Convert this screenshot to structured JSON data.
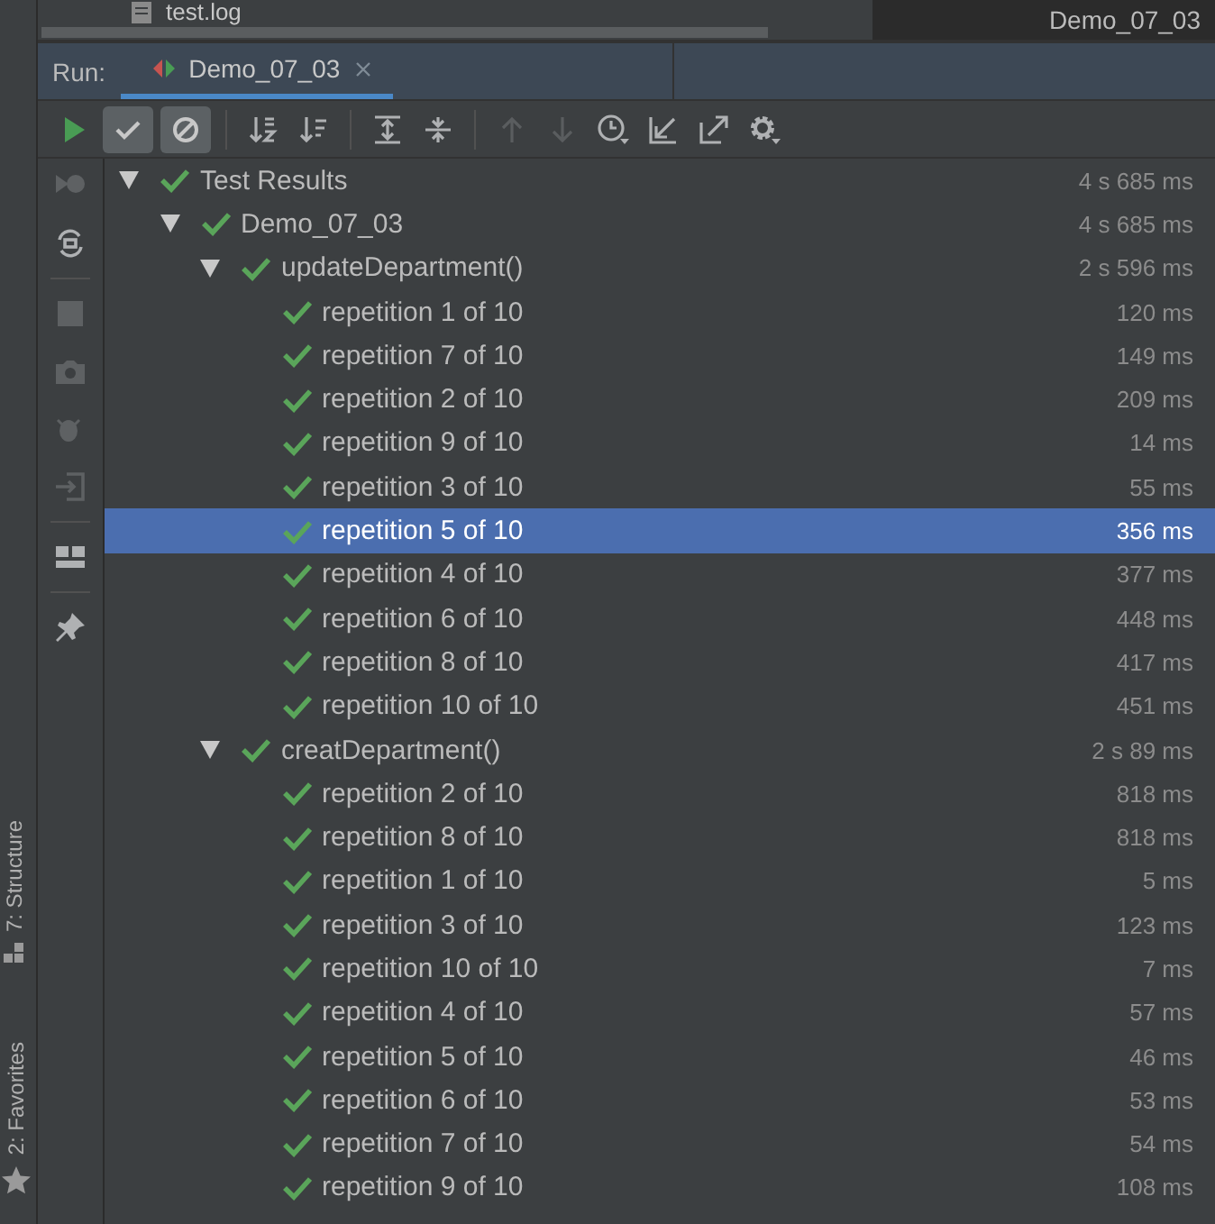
{
  "editor": {
    "file_tab": "test.log",
    "title": "Demo_07_03"
  },
  "run_bar": {
    "label": "Run:",
    "tabs": [
      {
        "label": "Demo_07_03",
        "selected": true
      }
    ]
  },
  "toolbar": [
    {
      "kind": "run"
    },
    {
      "kind": "passed",
      "on": true
    },
    {
      "kind": "ignored",
      "on": true
    },
    {
      "kind": "sep"
    },
    {
      "kind": "sort-alpha",
      "disabled": false
    },
    {
      "kind": "sort-duration",
      "disabled": false
    },
    {
      "kind": "sep"
    },
    {
      "kind": "expand",
      "disabled": false
    },
    {
      "kind": "collapse",
      "disabled": false
    },
    {
      "kind": "sep"
    },
    {
      "kind": "up",
      "disabled": true
    },
    {
      "kind": "down",
      "disabled": true
    },
    {
      "kind": "history",
      "disabled": false
    },
    {
      "kind": "import",
      "disabled": false
    },
    {
      "kind": "export",
      "disabled": false
    },
    {
      "kind": "settings",
      "disabled": false
    }
  ],
  "side_toolbar": [
    {
      "kind": "rerun-failed",
      "disabled": true
    },
    {
      "kind": "auto-test",
      "disabled": false
    },
    {
      "kind": "sep"
    },
    {
      "kind": "stop",
      "disabled": true
    },
    {
      "kind": "camera",
      "disabled": true
    },
    {
      "kind": "debug",
      "disabled": true
    },
    {
      "kind": "exit",
      "disabled": true
    },
    {
      "kind": "sep"
    },
    {
      "kind": "layout",
      "disabled": false
    },
    {
      "kind": "sep"
    },
    {
      "kind": "pin",
      "disabled": false
    }
  ],
  "side_tools": [
    {
      "label": "7: Structure",
      "kind": "structure"
    },
    {
      "label": "2: Favorites",
      "kind": "favorites"
    }
  ],
  "tree": [
    {
      "label": "Test Results",
      "time": "4 s 685 ms",
      "expanded": true,
      "selected": false,
      "children": [
        {
          "label": "Demo_07_03",
          "time": "4 s 685 ms",
          "expanded": true,
          "selected": false,
          "children": [
            {
              "label": "updateDepartment()",
              "time": "2 s 596 ms",
              "expanded": true,
              "selected": false,
              "children": [
                {
                  "label": "repetition 1 of 10",
                  "time": "120 ms",
                  "selected": false
                },
                {
                  "label": "repetition 7 of 10",
                  "time": "149 ms",
                  "selected": false
                },
                {
                  "label": "repetition 2 of 10",
                  "time": "209 ms",
                  "selected": false
                },
                {
                  "label": "repetition 9 of 10",
                  "time": "14 ms",
                  "selected": false
                },
                {
                  "label": "repetition 3 of 10",
                  "time": "55 ms",
                  "selected": false
                },
                {
                  "label": "repetition 5 of 10",
                  "time": "356 ms",
                  "selected": true
                },
                {
                  "label": "repetition 4 of 10",
                  "time": "377 ms",
                  "selected": false
                },
                {
                  "label": "repetition 6 of 10",
                  "time": "448 ms",
                  "selected": false
                },
                {
                  "label": "repetition 8 of 10",
                  "time": "417 ms",
                  "selected": false
                },
                {
                  "label": "repetition 10 of 10",
                  "time": "451 ms",
                  "selected": false
                }
              ]
            },
            {
              "label": "creatDepartment()",
              "time": "2 s 89 ms",
              "expanded": true,
              "selected": false,
              "children": [
                {
                  "label": "repetition 2 of 10",
                  "time": "818 ms",
                  "selected": false
                },
                {
                  "label": "repetition 8 of 10",
                  "time": "818 ms",
                  "selected": false
                },
                {
                  "label": "repetition 1 of 10",
                  "time": "5 ms",
                  "selected": false
                },
                {
                  "label": "repetition 3 of 10",
                  "time": "123 ms",
                  "selected": false
                },
                {
                  "label": "repetition 10 of 10",
                  "time": "7 ms",
                  "selected": false
                },
                {
                  "label": "repetition 4 of 10",
                  "time": "57 ms",
                  "selected": false
                },
                {
                  "label": "repetition 5 of 10",
                  "time": "46 ms",
                  "selected": false
                },
                {
                  "label": "repetition 6 of 10",
                  "time": "53 ms",
                  "selected": false
                },
                {
                  "label": "repetition 7 of 10",
                  "time": "54 ms",
                  "selected": false
                },
                {
                  "label": "repetition 9 of 10",
                  "time": "108 ms",
                  "selected": false
                }
              ]
            }
          ]
        }
      ]
    }
  ]
}
